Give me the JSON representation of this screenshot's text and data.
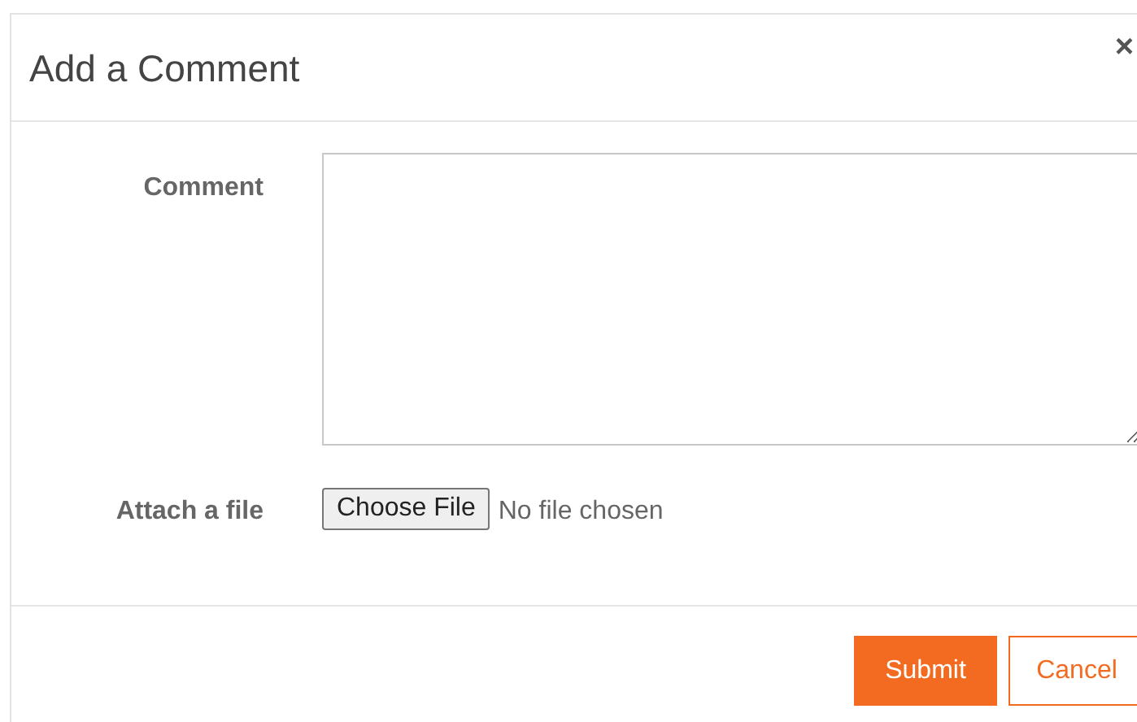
{
  "dialog": {
    "title": "Add a Comment",
    "close": "×"
  },
  "fields": [
    {
      "kind": "textarea",
      "label": "Comment"
    },
    {
      "kind": "file",
      "label": "Attach a file",
      "button": "Choose File",
      "status": "No file chosen"
    }
  ],
  "buttons": [
    {
      "kind": "primary",
      "label": "Submit"
    },
    {
      "kind": "secondary",
      "label": "Cancel"
    }
  ]
}
